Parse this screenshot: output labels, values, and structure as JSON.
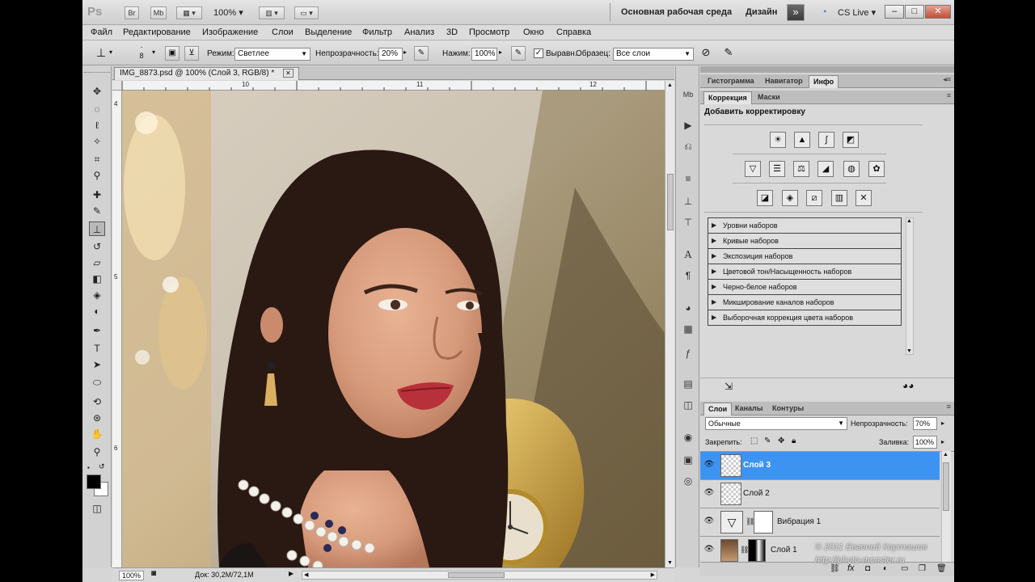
{
  "titlebar": {
    "logo": "Ps",
    "br": "Br",
    "mb": "Mb",
    "zoom": "100%",
    "workspace_active": "Основная рабочая среда",
    "workspace_design": "Дизайн",
    "cslive": "CS Live",
    "chevrons": "»"
  },
  "menu": [
    "Файл",
    "Редактирование",
    "Изображение",
    "Слои",
    "Выделение",
    "Фильтр",
    "Анализ",
    "3D",
    "Просмотр",
    "Окно",
    "Справка"
  ],
  "options": {
    "brush_size": "8",
    "mode_label": "Режим:",
    "mode_value": "Светлее",
    "opacity_label": "Непрозрачность:",
    "opacity_value": "20%",
    "pressure_label": "Нажим:",
    "pressure_value": "100%",
    "aligned_label": "Выравн.",
    "sample_label": "Образец:",
    "sample_value": "Все слои"
  },
  "document": {
    "tab_title": "IMG_8873.psd @ 100% (Слой 3, RGB/8) *",
    "ruler_top": [
      "10",
      "11",
      "12"
    ],
    "ruler_left": [
      "4",
      "5",
      "6"
    ],
    "zoom": "100%",
    "doc_size": "Док: 30,2M/72,1M"
  },
  "panel_top": {
    "tabs": [
      "Гистограмма",
      "Навигатор",
      "Инфо"
    ]
  },
  "panel_adjust": {
    "tabs": [
      "Коррекция",
      "Маски"
    ],
    "heading": "Добавить корректировку",
    "presets": [
      "Уровни наборов",
      "Кривые наборов",
      "Экспозиция наборов",
      "Цветовой тон/Насыщенность наборов",
      "Черно-белое наборов",
      "Микширование каналов наборов",
      "Выборочная коррекция цвета наборов"
    ]
  },
  "panel_layers": {
    "tabs": [
      "Слои",
      "Каналы",
      "Контуры"
    ],
    "blend_mode": "Обычные",
    "opacity_label": "Непрозрачность:",
    "opacity_value": "70%",
    "lock_label": "Закрепить:",
    "fill_label": "Заливка:",
    "fill_value": "100%",
    "layers": [
      {
        "name": "Слой 3",
        "selected": true
      },
      {
        "name": "Слой 2",
        "selected": false
      },
      {
        "name": "Вибрация 1",
        "selected": false
      },
      {
        "name": "Слой 1",
        "selected": false
      }
    ]
  },
  "watermark": {
    "line1": "© 2011 Евгений Карташов",
    "line2": "http://photo-monster.ru"
  }
}
